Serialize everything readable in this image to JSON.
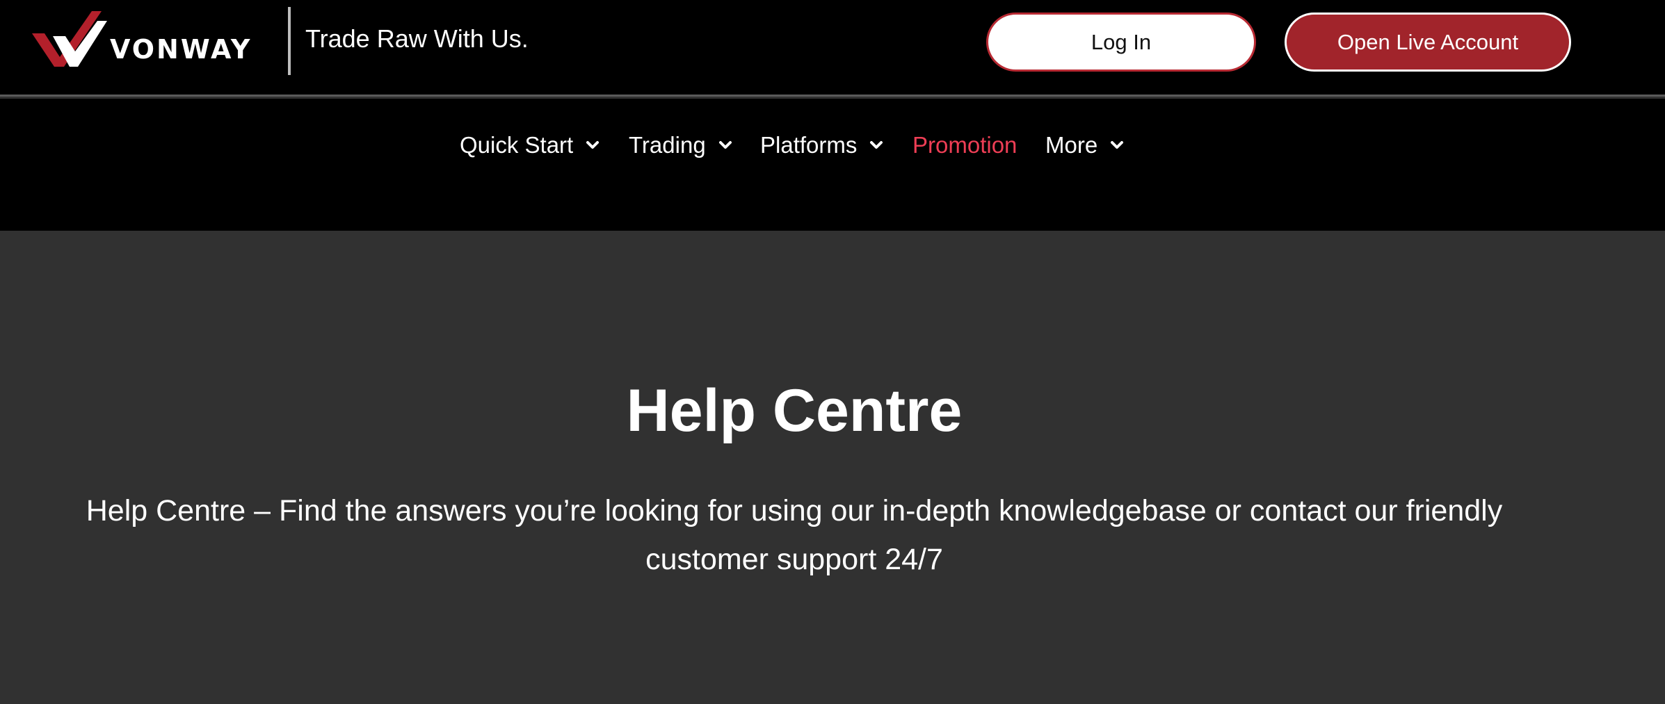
{
  "header": {
    "logo_text": "VONWAY",
    "tagline": "Trade Raw With Us.",
    "login_label": "Log In",
    "open_account_label": "Open Live Account",
    "accent_color": "#a1242b"
  },
  "nav": {
    "items": [
      {
        "label": "Quick Start",
        "dropdown": true
      },
      {
        "label": "Trading",
        "dropdown": true
      },
      {
        "label": "Platforms",
        "dropdown": true
      },
      {
        "label": "Promotion",
        "dropdown": false,
        "color": "#ee3e55"
      },
      {
        "label": "More",
        "dropdown": true
      }
    ]
  },
  "hero": {
    "title": "Help Centre",
    "subtitle": "Help Centre – Find the answers you’re looking for using our in-depth knowledgebase or contact our friendly customer support 24/7"
  }
}
